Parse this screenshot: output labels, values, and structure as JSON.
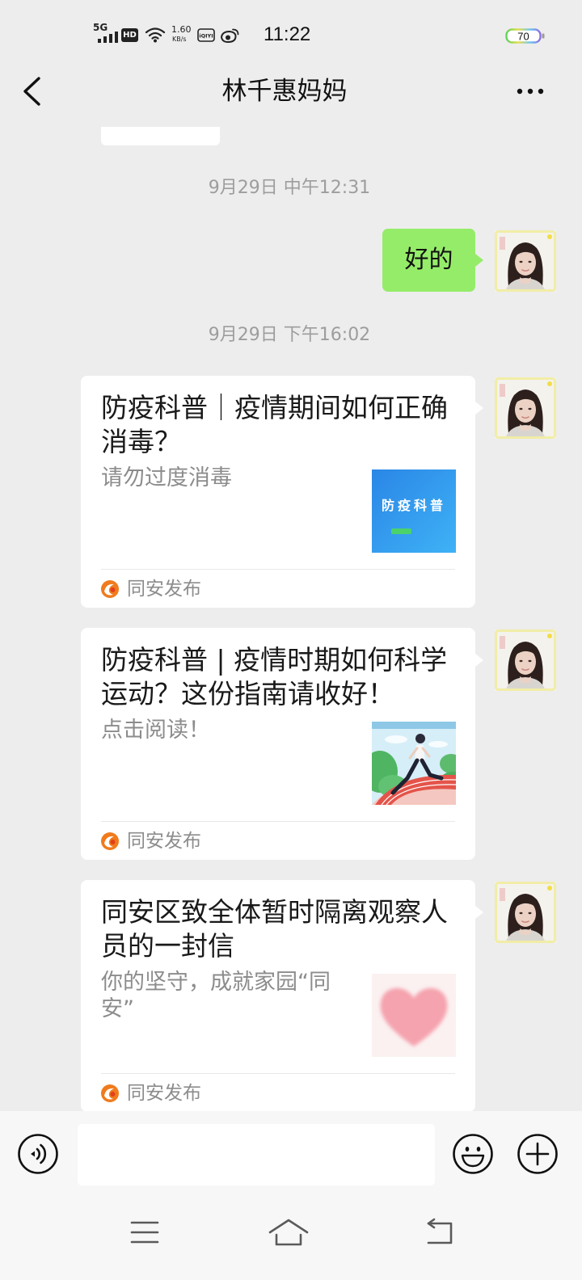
{
  "theme": {
    "chat_background": "#ededed",
    "sent_bubble": "#95ec69",
    "card_background": "#ffffff",
    "toolbar_background": "#f7f7f7",
    "source_logo": "#f07b1c"
  },
  "status_bar": {
    "network": "5G",
    "hd": "HD",
    "speed_value": "1.60",
    "speed_unit": "KB/s",
    "iqiyi_logo_text": "iQIYI",
    "time": "11:22",
    "battery": "70",
    "icons": [
      "signal-icon",
      "wifi-icon",
      "iqiyi-icon",
      "weibo-icon",
      "battery-icon"
    ]
  },
  "header": {
    "title": "林千惠妈妈",
    "back_icon": "chevron-left-icon",
    "more_icon": "more-icon"
  },
  "chat": {
    "timestamp_1": "9月29日 中午12:31",
    "sent_message": "好的",
    "timestamp_2": "9月29日 下午16:02",
    "cards": [
      {
        "title": "防疫科普｜疫情期间如何正确消毒？",
        "description": "请勿过度消毒",
        "thumbnail_text": "防疫科普",
        "source": "同安发布",
        "source_icon": "tongan-logo-icon"
      },
      {
        "title": "防疫科普 | 疫情时期如何科学运动？这份指南请收好！",
        "description": "点击阅读！",
        "source": "同安发布",
        "source_icon": "tongan-logo-icon"
      },
      {
        "title": "同安区致全体暂时隔离观察人员的一封信",
        "description": "你的坚守，成就家园“同安”",
        "source": "同安发布",
        "source_icon": "tongan-logo-icon"
      }
    ]
  },
  "input_bar": {
    "voice_icon": "voice-icon",
    "emoji_icon": "emoji-icon",
    "plus_icon": "plus-icon"
  },
  "nav_bar": {
    "icons": [
      "menu-icon",
      "home-icon",
      "back-icon"
    ]
  }
}
